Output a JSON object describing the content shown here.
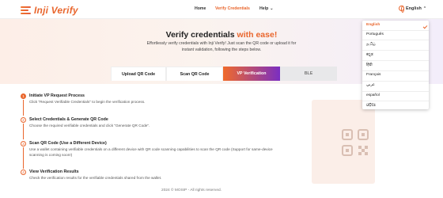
{
  "header": {
    "brand": "Inji Verify",
    "nav": [
      "Home",
      "Verify Credentials",
      "Help"
    ],
    "language_button": "English"
  },
  "hero": {
    "title_main": "Verify credentials ",
    "title_accent": "with ease!",
    "subtitle": "Effortlessly verify credentials with Inji Verify! Just scan the QR code or upload it for instant validation, following the steps below."
  },
  "tabs": [
    {
      "label": "Upload QR Code",
      "active": false
    },
    {
      "label": "Scan QR Code",
      "active": false
    },
    {
      "label": "VP Verification",
      "active": true
    },
    {
      "label": "BLE",
      "active": false
    }
  ],
  "steps": [
    {
      "num": "1",
      "title": "Initiate VP Request Process",
      "desc": "Click \"Request Verifiable Credentials\" to begin the verification process."
    },
    {
      "num": "2",
      "title": "Select Credentials & Generate QR Code",
      "desc": "Choose the required verifiable credentials and click \"Generate QR Code\"."
    },
    {
      "num": "3",
      "title": "Scan QR Code (Use a Different Device)",
      "desc": "Use a wallet containing verifiable credentials on a different device with QR code scanning capabilities to scan the QR code (Support for same-device scanning is coming soon!)"
    },
    {
      "num": "4",
      "title": "View Verification Results",
      "desc": "Check the verification results for the verifiable credentials shared from the wallet."
    }
  ],
  "footer": "2024 © MOSIP - All rights reserved.",
  "language_menu": {
    "selected": "English",
    "options": [
      "English",
      "Português",
      "தமிழ்",
      "ಕನ್ನಡ",
      "हिंदी",
      "Français",
      "عربي",
      "español",
      "ଓଡ଼ିଆ"
    ]
  },
  "colors": {
    "accent": "#e9662d",
    "purple": "#7a2ec2"
  }
}
